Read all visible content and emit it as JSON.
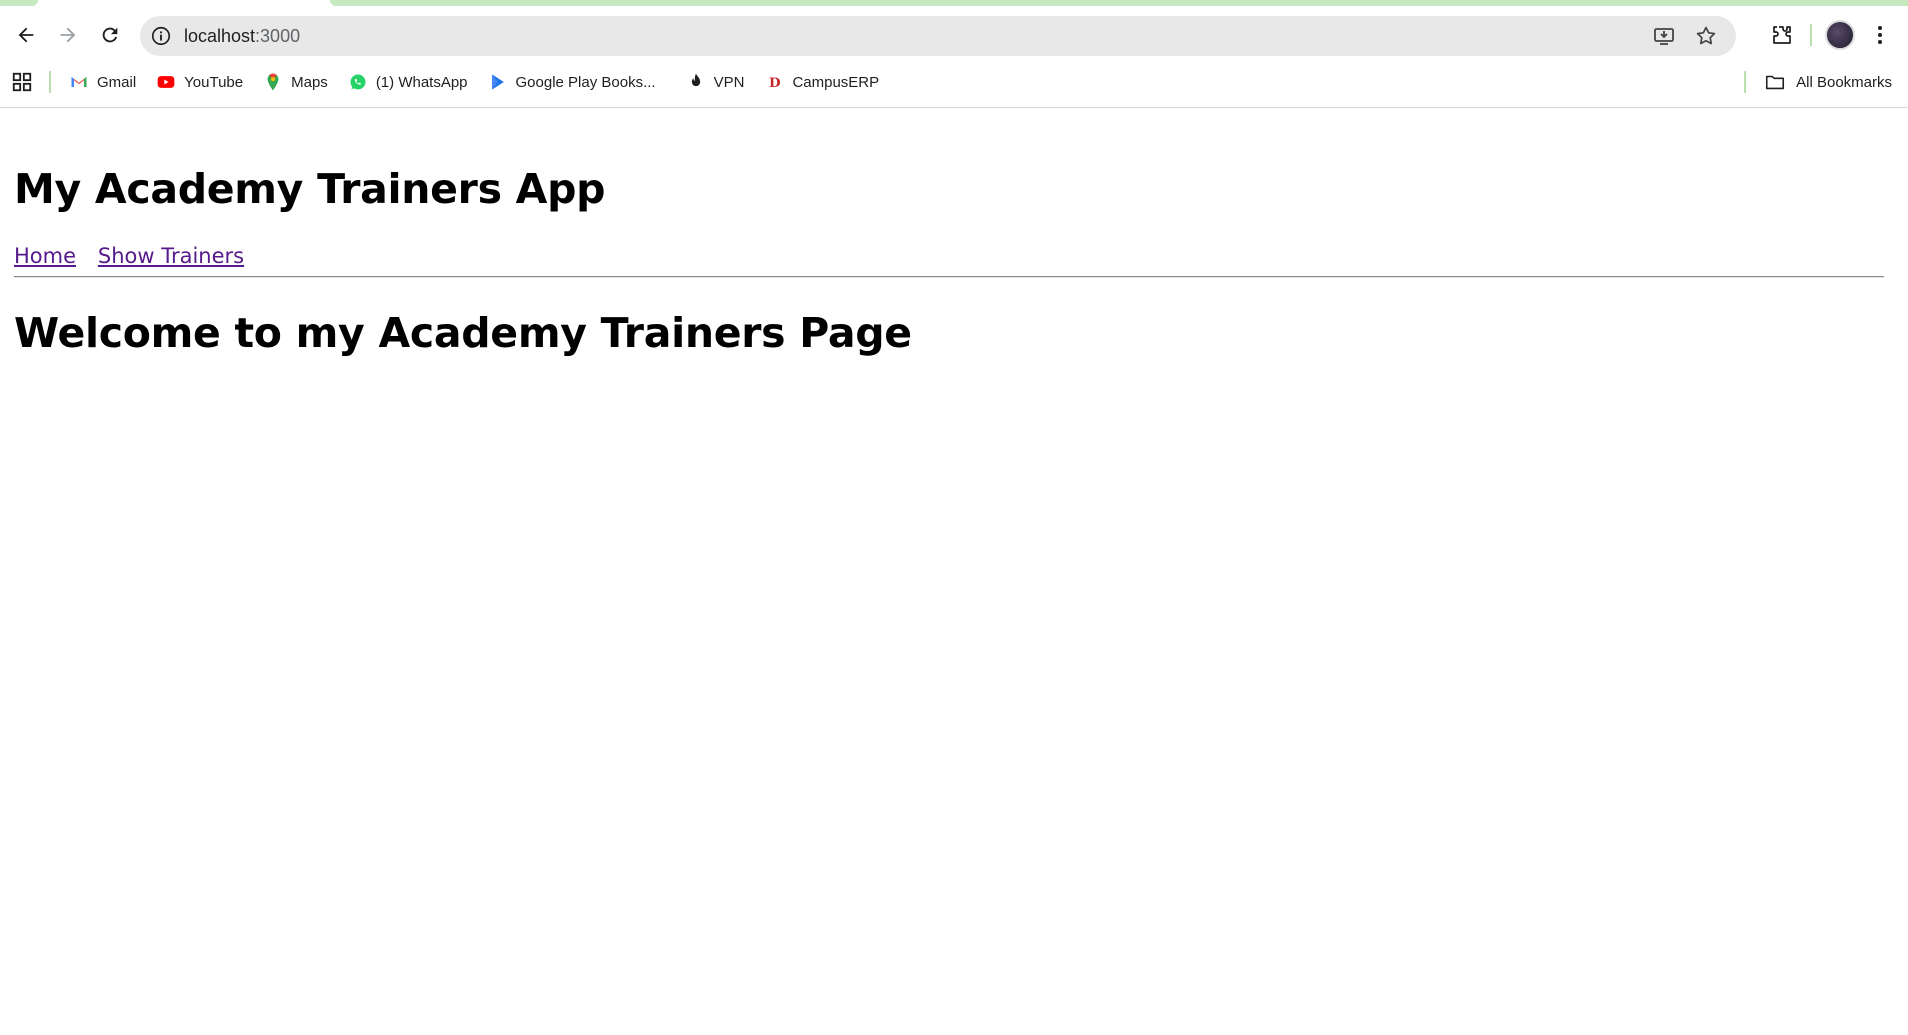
{
  "browser": {
    "url_host": "localhost",
    "url_port": ":3000",
    "bookmarks": [
      {
        "label": "Gmail",
        "icon": "gmail-icon"
      },
      {
        "label": "YouTube",
        "icon": "youtube-icon"
      },
      {
        "label": "Maps",
        "icon": "maps-icon"
      },
      {
        "label": "(1) WhatsApp",
        "icon": "whatsapp-icon"
      },
      {
        "label": "Google Play Books...",
        "icon": "play-books-icon"
      },
      {
        "label": "VPN",
        "icon": "vpn-icon"
      },
      {
        "label": "CampusERP",
        "icon": "campuserp-icon"
      }
    ],
    "all_bookmarks_label": "All Bookmarks"
  },
  "page": {
    "title": "My Academy Trainers App",
    "nav": {
      "home": "Home",
      "show_trainers": "Show Trainers"
    },
    "heading": "Welcome to my Academy Trainers Page"
  },
  "colors": {
    "link_visited": "#551a8b",
    "tab_accent": "#c6e8bf"
  }
}
